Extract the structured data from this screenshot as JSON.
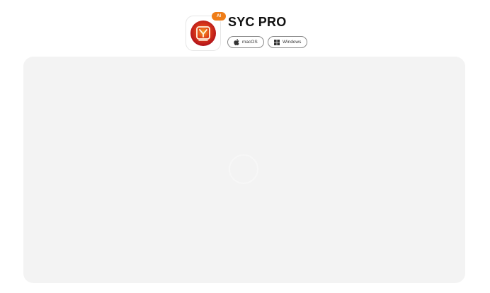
{
  "app": {
    "title": "SYC PRO",
    "badge": "AI",
    "icon": "syc-logo-icon"
  },
  "platforms": [
    {
      "label": "macOS",
      "icon": "apple-icon"
    },
    {
      "label": "Windows",
      "icon": "windows-icon"
    }
  ],
  "preview": {
    "state": "loading"
  },
  "colors": {
    "badge": "#ef7d17",
    "logo_red": "#c8151b",
    "logo_yellow": "#f5c518",
    "panel_bg": "#f3f3f3"
  }
}
